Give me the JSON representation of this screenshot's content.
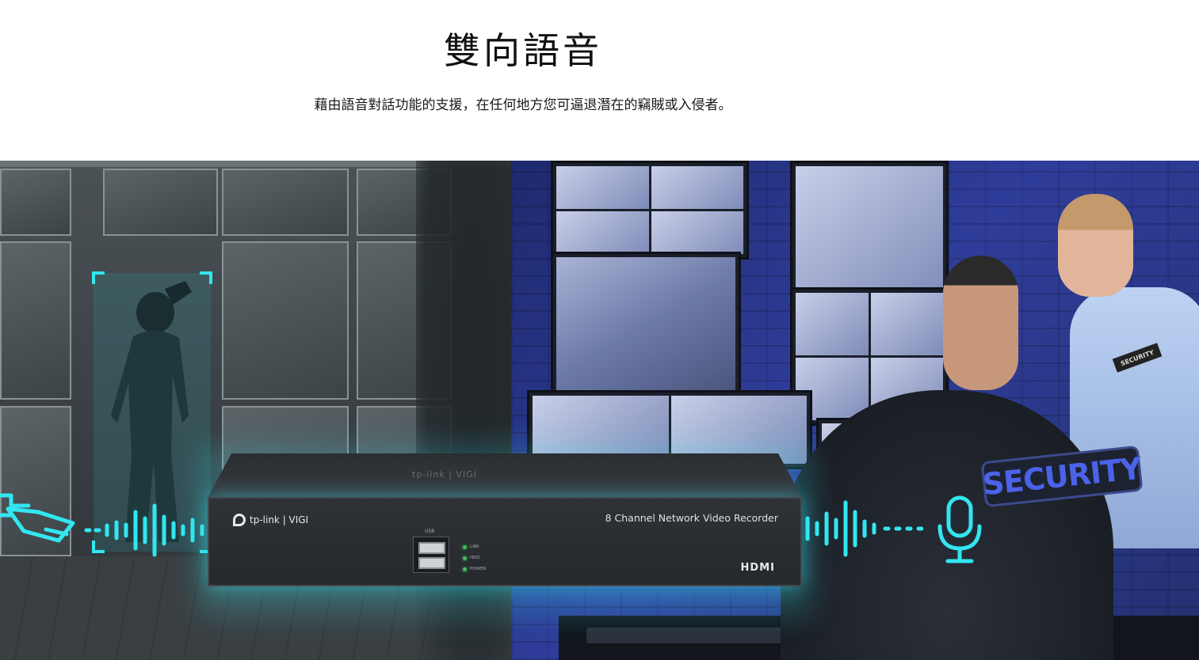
{
  "header": {
    "title": "雙向語音",
    "subtitle": "藉由語音對話功能的支援，在任何地方您可逼退潛在的竊賊或入侵者。"
  },
  "device": {
    "brand": "tp-link | VIGI",
    "model_text": "8 Channel Network Video Recorder",
    "usb_label": "USB",
    "leds": [
      "LAN",
      "HDD",
      "POWER"
    ],
    "hdmi_label": "HDMI",
    "top_logo": "tp-link | VIGI"
  },
  "scene": {
    "security_patch": "SECURITY",
    "shoulder_tag": "SECURITY"
  },
  "icons": {
    "left": "security-camera-icon",
    "right": "microphone-icon"
  },
  "colors": {
    "accent_cyan": "#32e6f0",
    "device_glow": "#3ce6f0",
    "patch_blue": "#4a63e8"
  }
}
